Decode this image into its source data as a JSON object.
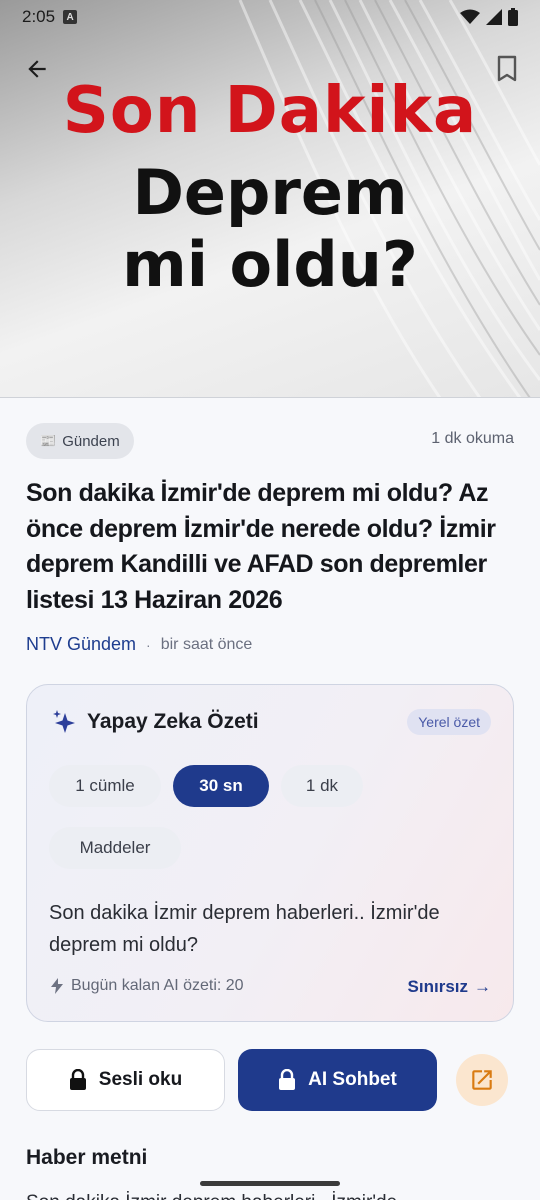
{
  "status": {
    "time": "2:05",
    "a_badge": "A"
  },
  "hero": {
    "line1": "Son Dakika",
    "line2": "Deprem",
    "line3": "mi oldu?",
    "colors": {
      "red": "#d2141b"
    }
  },
  "meta": {
    "category_icon": "📰",
    "category": "Gündem",
    "read_time": "1 dk okuma"
  },
  "headline": "Son dakika İzmir'de deprem mi oldu? Az önce deprem İzmir'de nerede oldu? İzmir deprem Kandilli ve AFAD son depremler listesi 13 Haziran 2026",
  "source": {
    "name": "NTV Gündem",
    "separator": "·",
    "time": "bir saat önce"
  },
  "ai_summary": {
    "title": "Yapay Zeka Özeti",
    "badge": "Yerel özet",
    "options": [
      {
        "label": "1 cümle",
        "active": false
      },
      {
        "label": "30 sn",
        "active": true
      },
      {
        "label": "1 dk",
        "active": false
      },
      {
        "label": "Maddeler",
        "active": false
      }
    ],
    "text": "Son dakika İzmir deprem haberleri.. İzmir'de deprem mi oldu?",
    "quota": "Bugün kalan AI özeti: 20",
    "unlimited": "Sınırsız",
    "unlimited_arrow": "→"
  },
  "actions": {
    "listen": "Sesli oku",
    "chat": "AI Sohbet"
  },
  "article": {
    "section_title": "Haber metni",
    "body_start": "Son dakika İzmir deprem haberleri.. İzmir'de"
  },
  "theme": {
    "primary": "#1f3a8c",
    "accent_bg": "#fbe6cf"
  }
}
